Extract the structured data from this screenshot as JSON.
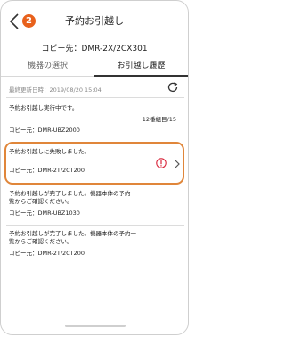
{
  "header": {
    "title": "予約お引越し",
    "badge": "2"
  },
  "copy_destination": "コピー先：DMR-2X/2CX301",
  "tabs": [
    {
      "label": "機器の選択"
    },
    {
      "label": "お引越し履歴"
    }
  ],
  "last_updated": "最終更新日時：2019/08/20 15:04",
  "history": [
    {
      "message": "予約お引越し実行中です。",
      "progress": "12番組目/15",
      "source": "コピー元：DMR-UBZ2000"
    },
    {
      "message": "予約お引越しに失敗しました。",
      "source": "コピー元：DMR-2T/2CT200"
    },
    {
      "message_line1": "予約お引越しが完了しました。機器本体の予約一",
      "message_line2": "覧からご確認ください。",
      "source": "コピー元：DMR-UBZ1030"
    },
    {
      "message_line1": "予約お引越しが完了しました。機器本体の予約一",
      "message_line2": "覧からご確認ください。",
      "source": "コピー元：DMR-2T/2CT200"
    }
  ],
  "colors": {
    "accent_orange": "#e8611c",
    "highlight_border": "#e0863a",
    "error_red": "#d9263b"
  }
}
